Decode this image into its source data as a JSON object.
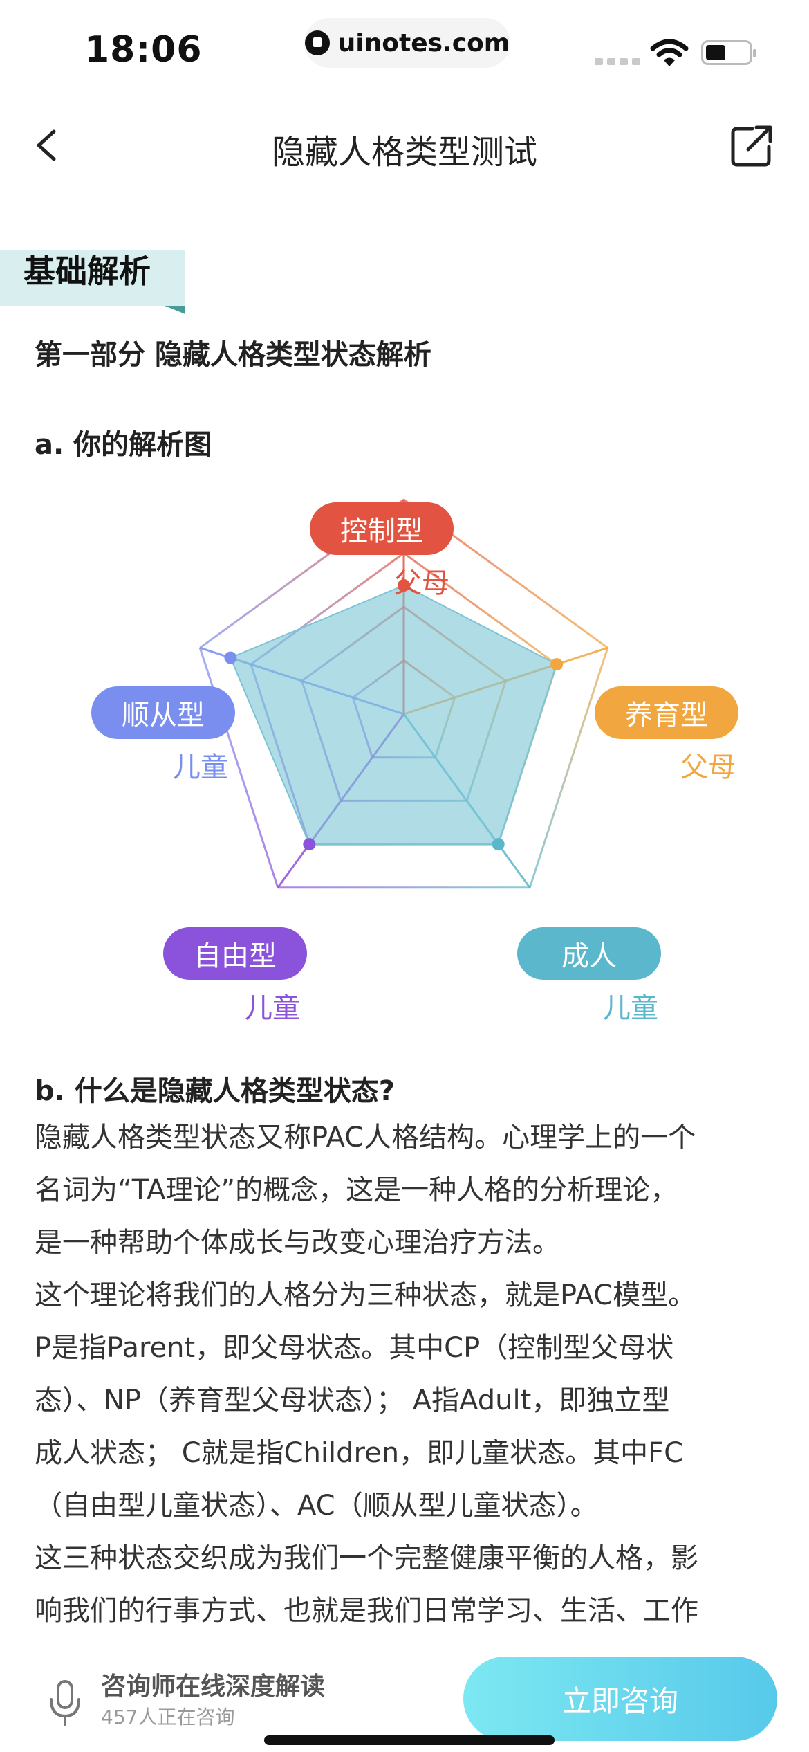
{
  "status_bar": {
    "time": "18:06",
    "url": "uinotes.com"
  },
  "nav": {
    "title": "隐藏人格类型测试"
  },
  "section": {
    "tag": "基础解析",
    "part_title": "第一部分 隐藏人格类型状态解析"
  },
  "analysis": {
    "heading_a": "a. 你的解析图"
  },
  "radar": {
    "axes": [
      {
        "label": "控制型",
        "sub": "父母",
        "color": "#e25341"
      },
      {
        "label": "养育型",
        "sub": "父母",
        "color": "#f2a640"
      },
      {
        "label": "成人",
        "sub": "儿童",
        "color": "#5bb8cc"
      },
      {
        "label": "自由型",
        "sub": "儿童",
        "color": "#8b52db"
      },
      {
        "label": "顺从型",
        "sub": "儿童",
        "color": "#7a8ef0"
      }
    ]
  },
  "chart_data": {
    "type": "radar",
    "categories": [
      "控制型 父母",
      "养育型 父母",
      "成人 儿童",
      "自由型 儿童",
      "顺从型 儿童"
    ],
    "series": [
      {
        "values": [
          0.6,
          0.75,
          0.75,
          0.75,
          0.85
        ]
      }
    ],
    "range": [
      0,
      1
    ],
    "rings": 4,
    "fill_color": "#7cc5d6"
  },
  "explanation": {
    "heading_b": "b. 什么是隐藏人格类型状态?",
    "lines": [
      "隐藏人格类型状态又称PAC人格结构。心理学上的一个",
      "名词为“TA理论”的概念，这是一种人格的分析理论，",
      "是一种帮助个体成长与改变心理治疗方法。",
      "这个理论将我们的人格分为三种状态，就是PAC模型。",
      "P是指Parent，即父母状态。其中CP（控制型父母状",
      "态）、NP（养育型父母状态）； A指Adult，即独立型",
      "成人状态； C就是指Children，即儿童状态。其中FC",
      "（自由型儿童状态）、AC（顺从型儿童状态）。",
      "这三种状态交织成为我们一个完整健康平衡的人格，影",
      "响我们的行事方式、也就是我们日常学习、生活、工作"
    ]
  },
  "bottom": {
    "consult_title": "咨询师在线深度解读",
    "consult_sub": "457人正在咨询",
    "consult_button": "立即咨询"
  }
}
